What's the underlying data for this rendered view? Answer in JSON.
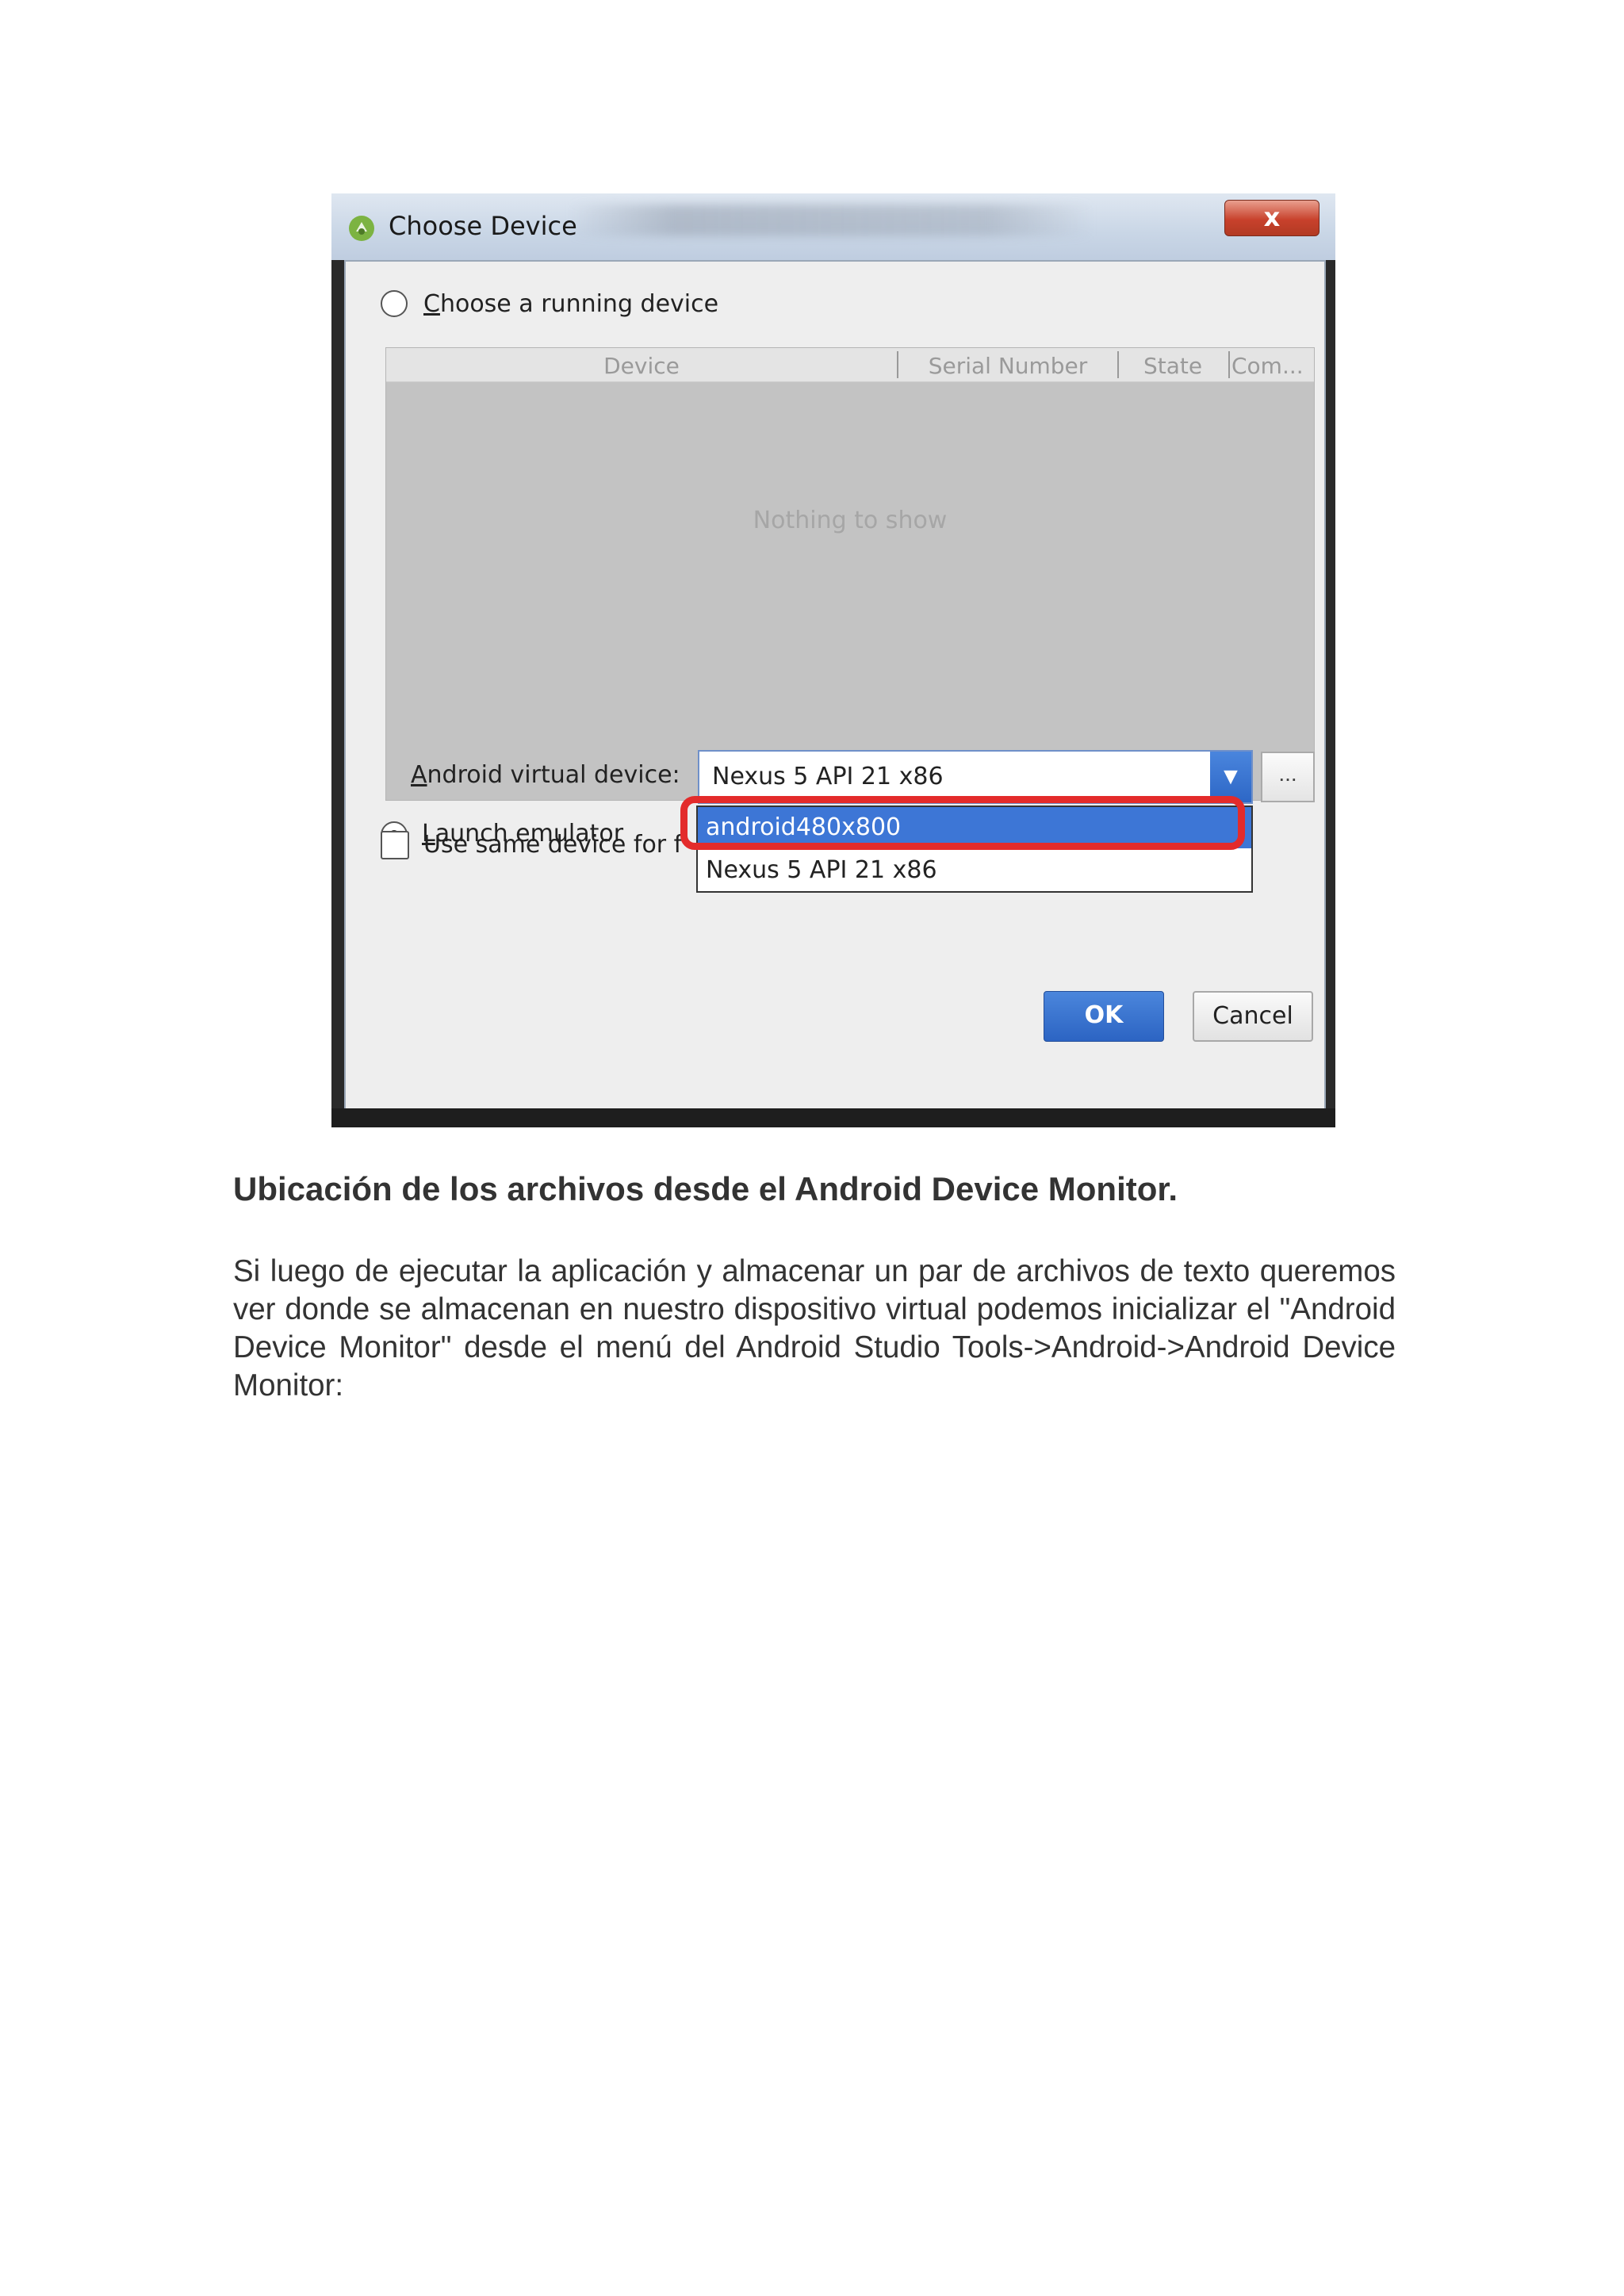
{
  "dialog": {
    "title": "Choose Device",
    "close_glyph": "x",
    "running_device_option": {
      "label_first": "C",
      "label_rest": "hoose a running device",
      "selected": false
    },
    "device_table": {
      "columns": [
        "Device",
        "Serial Number",
        "State",
        "Com..."
      ],
      "empty_message": "Nothing to show"
    },
    "launch_emulator_option": {
      "label_first": "L",
      "label_rest": "aunch emulator",
      "selected": true
    },
    "avd_label_first": "A",
    "avd_label_rest": "ndroid virtual device:",
    "avd_combo": {
      "value": "Nexus 5 API 21 x86",
      "arrow_glyph": "▼",
      "more_button": "..."
    },
    "avd_dropdown_options": [
      "android480x800",
      "Nexus 5 API 21 x86"
    ],
    "avd_dropdown_selected": "android480x800",
    "same_device_checkbox": {
      "label": "Use same device for f",
      "checked": false
    },
    "ok_button": "OK",
    "cancel_button": "Cancel"
  },
  "document": {
    "heading": "Ubicación de los archivos desde el Android Device Monitor.",
    "paragraph": "Si luego de ejecutar la aplicación y almacenar un par de archivos de texto queremos ver donde se almacenan en nuestro dispositivo virtual podemos inicializar el \"Android Device Monitor\" desde el menú del Android Studio Tools->Android->Android Device Monitor:"
  },
  "colors": {
    "highlight_ring": "#e32b2b",
    "selection": "#3d76d6",
    "ok_button": "#2c64c3"
  }
}
